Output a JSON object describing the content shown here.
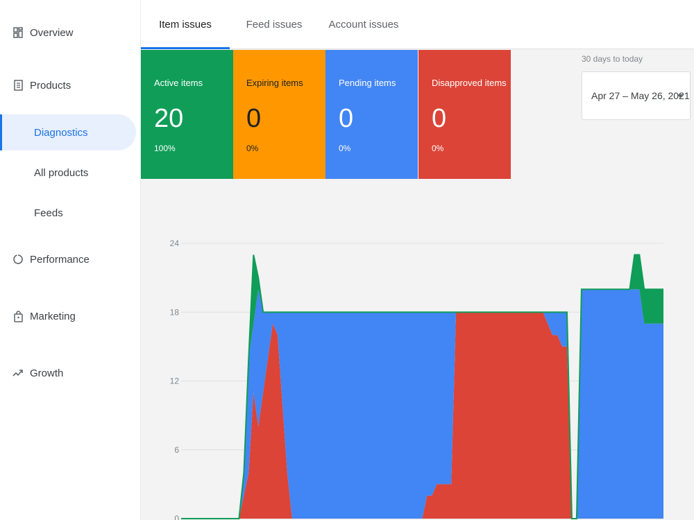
{
  "sidebar": {
    "items": [
      {
        "label": "Overview",
        "icon": "dashboard-icon"
      },
      {
        "label": "Products",
        "icon": "products-icon",
        "children": [
          {
            "label": "Diagnostics",
            "active": true
          },
          {
            "label": "All products"
          },
          {
            "label": "Feeds"
          }
        ]
      },
      {
        "label": "Performance",
        "icon": "performance-icon"
      },
      {
        "label": "Marketing",
        "icon": "marketing-icon"
      },
      {
        "label": "Growth",
        "icon": "growth-icon"
      }
    ]
  },
  "tabs": [
    {
      "label": "Item issues",
      "active": true
    },
    {
      "label": "Feed issues"
    },
    {
      "label": "Account issues"
    }
  ],
  "summary_cards": [
    {
      "label": "Active items",
      "value": "20",
      "percent": "100%",
      "color": "#0f9d58"
    },
    {
      "label": "Expiring items",
      "value": "0",
      "percent": "0%",
      "color": "#ff9800"
    },
    {
      "label": "Pending items",
      "value": "0",
      "percent": "0%",
      "color": "#4285f4"
    },
    {
      "label": "Disapproved items",
      "value": "0",
      "percent": "0%",
      "color": "#db4437"
    }
  ],
  "date_range": {
    "caption": "30 days to today",
    "value": "Apr 27 – May 26, 2021"
  },
  "colors": {
    "accent": "#1a73e8",
    "active": "#0f9d58",
    "expiring": "#ff9800",
    "pending": "#4285f4",
    "disapproved": "#db4437"
  },
  "chart_data": {
    "type": "area",
    "ylim": [
      0,
      24
    ],
    "yticks": [
      "0",
      "6",
      "12",
      "18",
      "24"
    ],
    "x": [
      0,
      1,
      2,
      3,
      4,
      5,
      6,
      7,
      8,
      9,
      10,
      11,
      12,
      13,
      14,
      15,
      16,
      17,
      18,
      19,
      20,
      21,
      22,
      23,
      24,
      25,
      26,
      27,
      28,
      29,
      30,
      31,
      32,
      33,
      34,
      35,
      36,
      37,
      38,
      39,
      40,
      41,
      42,
      43,
      44,
      45,
      46,
      47,
      48,
      49,
      50,
      51,
      52,
      53,
      54,
      55,
      56,
      57,
      58,
      59,
      60,
      61,
      62,
      63,
      64,
      65,
      66,
      67,
      68,
      69,
      70,
      71,
      72,
      73,
      74,
      75,
      76,
      77,
      78,
      79,
      80,
      81,
      82,
      83,
      84,
      85,
      86,
      87,
      88,
      89,
      90,
      91,
      92,
      93,
      94,
      95,
      96,
      97,
      98,
      99,
      100
    ],
    "series": [
      {
        "name": "Disapproved",
        "color": "#db4437",
        "values": [
          0,
          0,
          0,
          0,
          0,
          0,
          0,
          0,
          0,
          0,
          0,
          0,
          0,
          2,
          4,
          11,
          8,
          11,
          14,
          17,
          16,
          10,
          4,
          0,
          0,
          0,
          0,
          0,
          0,
          0,
          0,
          0,
          0,
          0,
          0,
          0,
          0,
          0,
          0,
          0,
          0,
          0,
          0,
          0,
          0,
          0,
          0,
          0,
          0,
          0,
          0,
          2,
          2,
          3,
          3,
          3,
          3,
          18,
          18,
          18,
          18,
          18,
          18,
          18,
          18,
          18,
          18,
          18,
          18,
          18,
          18,
          18,
          18,
          18,
          18,
          18,
          17,
          16,
          16,
          15,
          15,
          0,
          0,
          0,
          0,
          0,
          0,
          0,
          0,
          0,
          0,
          0,
          0,
          0,
          0,
          0,
          0,
          0,
          0,
          0,
          0
        ]
      },
      {
        "name": "Pending",
        "color": "#4285f4",
        "values": [
          0,
          0,
          0,
          0,
          0,
          0,
          0,
          0,
          0,
          0,
          0,
          0,
          0,
          2,
          10,
          6,
          12,
          7,
          4,
          1,
          2,
          8,
          14,
          18,
          18,
          18,
          18,
          18,
          18,
          18,
          18,
          18,
          18,
          18,
          18,
          18,
          18,
          18,
          18,
          18,
          18,
          18,
          18,
          18,
          18,
          18,
          18,
          18,
          18,
          18,
          18,
          16,
          16,
          15,
          15,
          15,
          15,
          0,
          0,
          0,
          0,
          0,
          0,
          0,
          0,
          0,
          0,
          0,
          0,
          0,
          0,
          0,
          0,
          0,
          0,
          0,
          1,
          2,
          2,
          3,
          3,
          0,
          0,
          20,
          20,
          20,
          20,
          20,
          20,
          20,
          20,
          20,
          20,
          20,
          20,
          20,
          17,
          17,
          17,
          17,
          17
        ]
      },
      {
        "name": "Active",
        "color": "#0f9d58",
        "values": [
          0,
          0,
          0,
          0,
          0,
          0,
          0,
          0,
          0,
          0,
          0,
          0,
          0,
          0,
          0,
          6,
          1,
          0,
          0,
          0,
          0,
          0,
          0,
          0,
          0,
          0,
          0,
          0,
          0,
          0,
          0,
          0,
          0,
          0,
          0,
          0,
          0,
          0,
          0,
          0,
          0,
          0,
          0,
          0,
          0,
          0,
          0,
          0,
          0,
          0,
          0,
          0,
          0,
          0,
          0,
          0,
          0,
          0,
          0,
          0,
          0,
          0,
          0,
          0,
          0,
          0,
          0,
          0,
          0,
          0,
          0,
          0,
          0,
          0,
          0,
          0,
          0,
          0,
          0,
          0,
          0,
          0,
          0,
          0,
          0,
          0,
          0,
          0,
          0,
          0,
          0,
          0,
          0,
          0,
          3,
          3,
          3,
          3,
          3,
          3,
          3
        ]
      }
    ]
  }
}
